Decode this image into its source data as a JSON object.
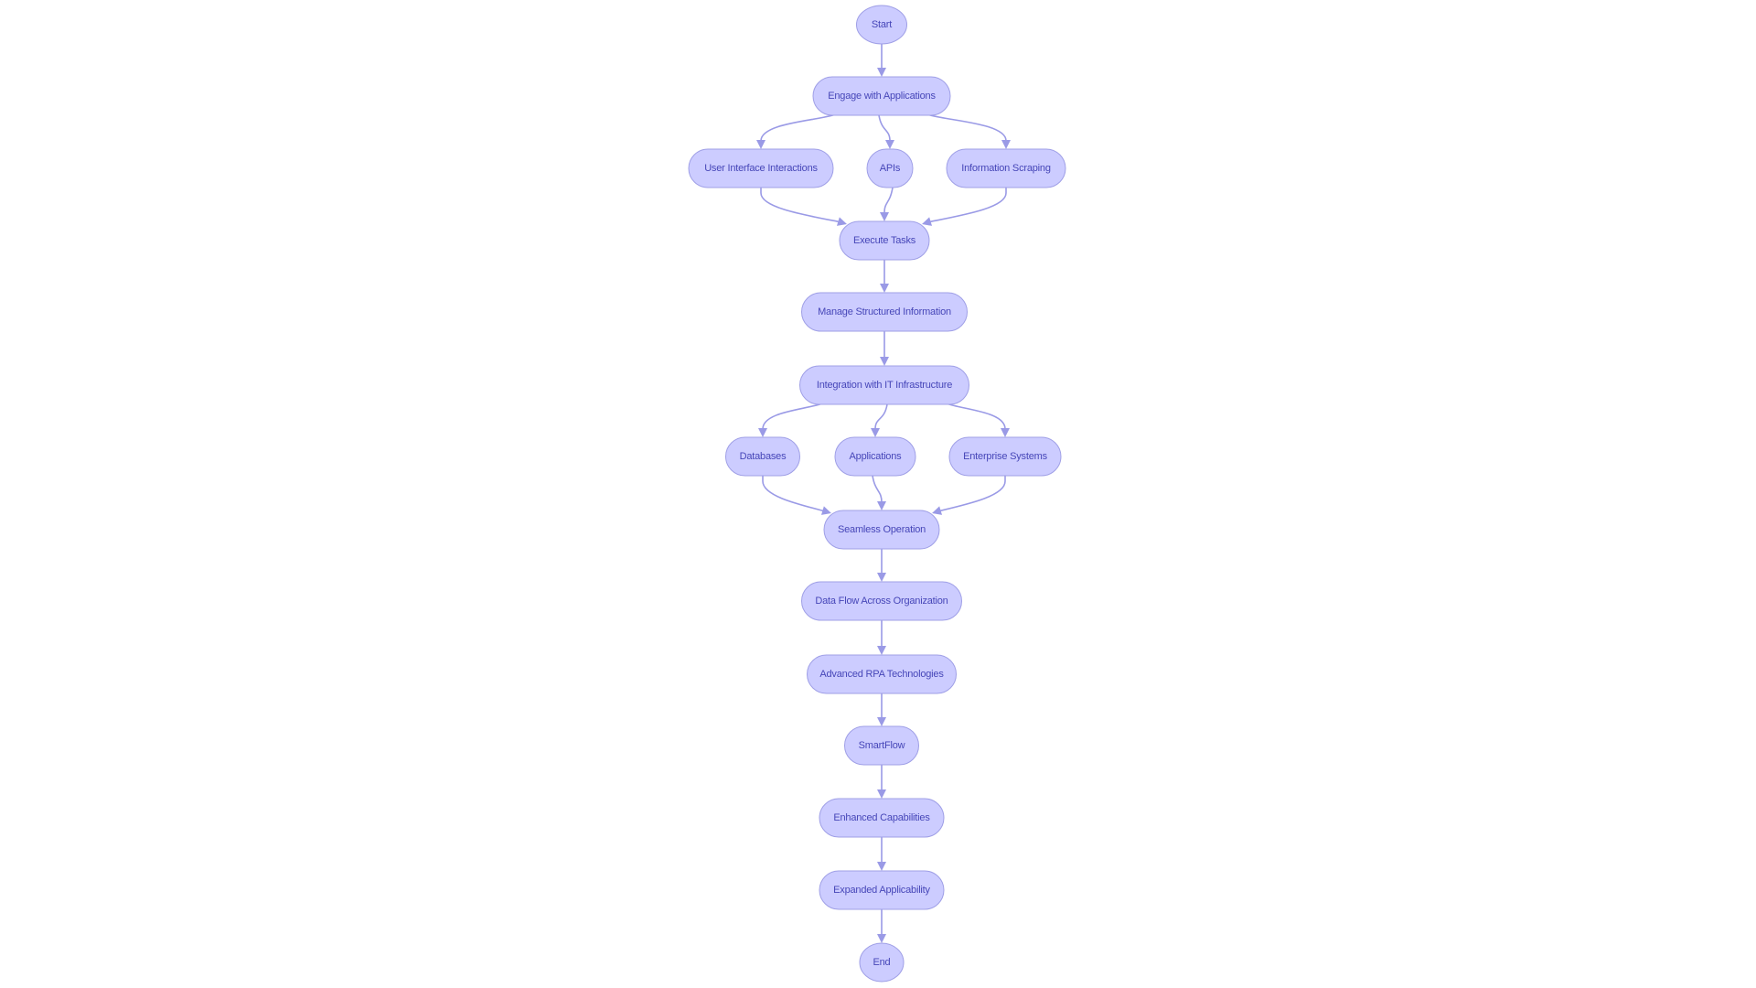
{
  "diagram": {
    "type": "flowchart",
    "direction": "top-down",
    "colors": {
      "node_fill": "#ccccff",
      "node_stroke": "#9f9fe6",
      "text": "#4646b8",
      "edge": "#9a9ae6",
      "background": "#ffffff"
    },
    "nodes": [
      {
        "id": "start",
        "label": "Start",
        "shape": "circle"
      },
      {
        "id": "engage",
        "label": "Engage with Applications",
        "shape": "stadium"
      },
      {
        "id": "ui",
        "label": "User Interface Interactions",
        "shape": "stadium"
      },
      {
        "id": "apis",
        "label": "APIs",
        "shape": "stadium"
      },
      {
        "id": "scraping",
        "label": "Information Scraping",
        "shape": "stadium"
      },
      {
        "id": "execute",
        "label": "Execute Tasks",
        "shape": "stadium"
      },
      {
        "id": "manage",
        "label": "Manage Structured Information",
        "shape": "stadium"
      },
      {
        "id": "integration",
        "label": "Integration with IT Infrastructure",
        "shape": "stadium"
      },
      {
        "id": "databases",
        "label": "Databases",
        "shape": "stadium"
      },
      {
        "id": "applications",
        "label": "Applications",
        "shape": "stadium"
      },
      {
        "id": "enterprise",
        "label": "Enterprise Systems",
        "shape": "stadium"
      },
      {
        "id": "seamless",
        "label": "Seamless Operation",
        "shape": "stadium"
      },
      {
        "id": "dataflow",
        "label": "Data Flow Across Organization",
        "shape": "stadium"
      },
      {
        "id": "rpa",
        "label": "Advanced RPA Technologies",
        "shape": "stadium"
      },
      {
        "id": "smartflow",
        "label": "SmartFlow",
        "shape": "stadium"
      },
      {
        "id": "enhanced",
        "label": "Enhanced Capabilities",
        "shape": "stadium"
      },
      {
        "id": "expanded",
        "label": "Expanded Applicability",
        "shape": "stadium"
      },
      {
        "id": "end",
        "label": "End",
        "shape": "circle"
      }
    ],
    "edges": [
      {
        "from": "start",
        "to": "engage"
      },
      {
        "from": "engage",
        "to": "ui"
      },
      {
        "from": "engage",
        "to": "apis"
      },
      {
        "from": "engage",
        "to": "scraping"
      },
      {
        "from": "ui",
        "to": "execute"
      },
      {
        "from": "apis",
        "to": "execute"
      },
      {
        "from": "scraping",
        "to": "execute"
      },
      {
        "from": "execute",
        "to": "manage"
      },
      {
        "from": "manage",
        "to": "integration"
      },
      {
        "from": "integration",
        "to": "databases"
      },
      {
        "from": "integration",
        "to": "applications"
      },
      {
        "from": "integration",
        "to": "enterprise"
      },
      {
        "from": "databases",
        "to": "seamless"
      },
      {
        "from": "applications",
        "to": "seamless"
      },
      {
        "from": "enterprise",
        "to": "seamless"
      },
      {
        "from": "seamless",
        "to": "dataflow"
      },
      {
        "from": "dataflow",
        "to": "rpa"
      },
      {
        "from": "rpa",
        "to": "smartflow"
      },
      {
        "from": "smartflow",
        "to": "enhanced"
      },
      {
        "from": "enhanced",
        "to": "expanded"
      },
      {
        "from": "expanded",
        "to": "end"
      }
    ]
  }
}
